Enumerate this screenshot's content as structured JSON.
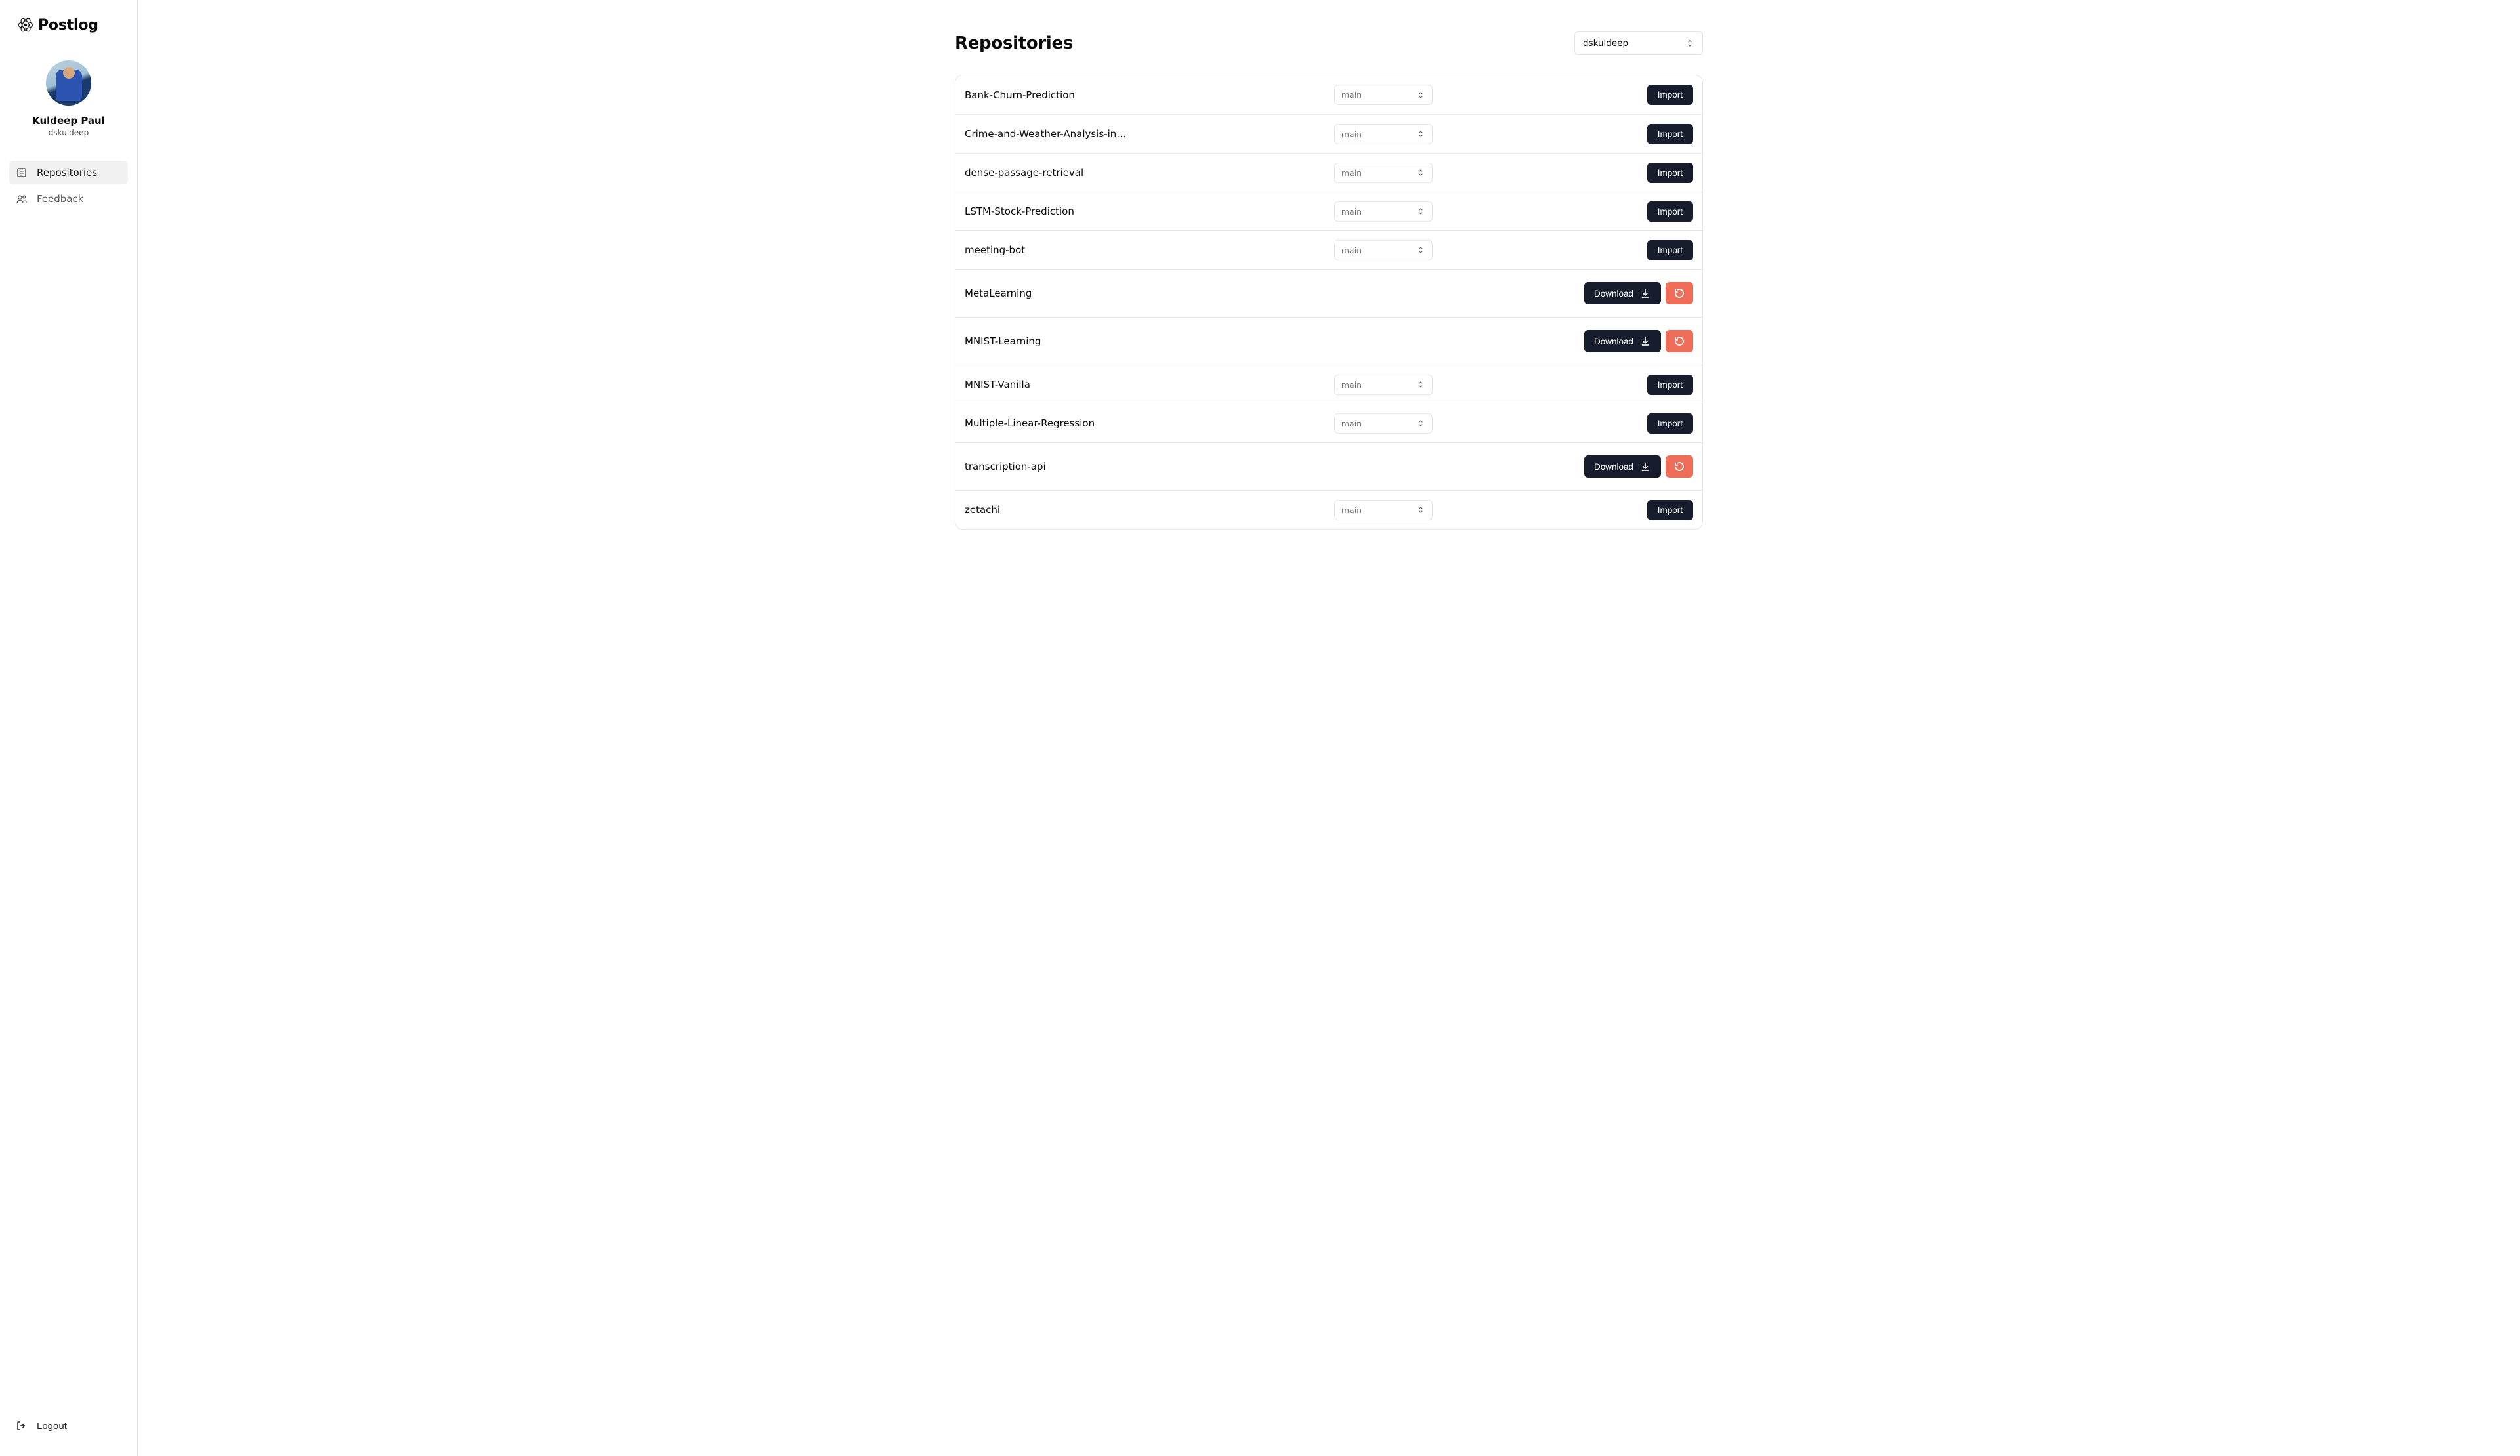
{
  "brand": "Postlog",
  "user": {
    "display_name": "Kuldeep Paul",
    "handle": "dskuldeep"
  },
  "nav": {
    "repositories": "Repositories",
    "feedback": "Feedback"
  },
  "logout_label": "Logout",
  "page_title": "Repositories",
  "org_selected": "dskuldeep",
  "branch_default": "main",
  "buttons": {
    "import": "Import",
    "download": "Download"
  },
  "repos": [
    {
      "name": "Bank-Churn-Prediction",
      "state": "import"
    },
    {
      "name": "Crime-and-Weather-Analysis-in-Col",
      "state": "import"
    },
    {
      "name": "dense-passage-retrieval",
      "state": "import"
    },
    {
      "name": "LSTM-Stock-Prediction",
      "state": "import"
    },
    {
      "name": "meeting-bot",
      "state": "import"
    },
    {
      "name": "MetaLearning",
      "state": "download"
    },
    {
      "name": "MNIST-Learning",
      "state": "download"
    },
    {
      "name": "MNIST-Vanilla",
      "state": "import"
    },
    {
      "name": "Multiple-Linear-Regression",
      "state": "import"
    },
    {
      "name": "transcription-api",
      "state": "download"
    },
    {
      "name": "zetachi",
      "state": "import"
    }
  ]
}
